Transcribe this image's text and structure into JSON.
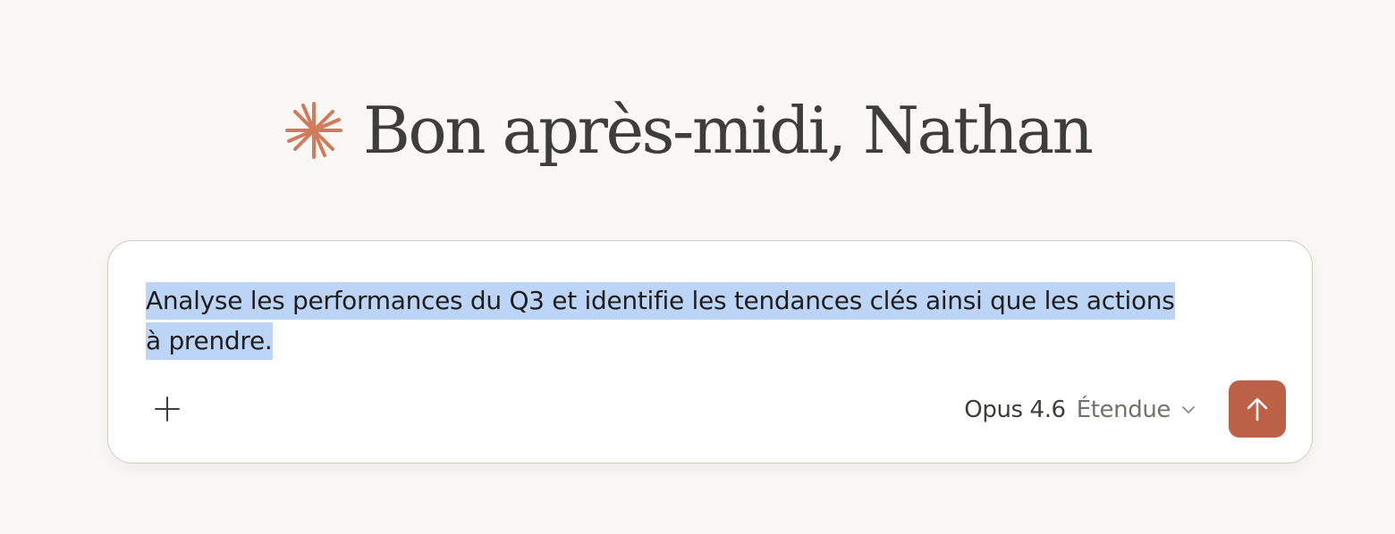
{
  "greeting": {
    "text": "Bon après-midi, Nathan",
    "icon": "spark-icon"
  },
  "composer": {
    "prompt_line_1": "Analyse les performances du Q3 et identifie les tendances clés ainsi que les actions ",
    "prompt_line_2": "à prendre.",
    "add_icon": "plus-icon",
    "model": {
      "name": "Opus 4.6",
      "mode": "Étendue",
      "icon": "chevron-down-icon"
    },
    "send_icon": "arrow-up-icon"
  },
  "colors": {
    "background": "#f9f8f5",
    "accent": "#bd6146",
    "spark": "#d27a5b",
    "selection": "#bcd5f6",
    "text": "#3d3d3a"
  }
}
